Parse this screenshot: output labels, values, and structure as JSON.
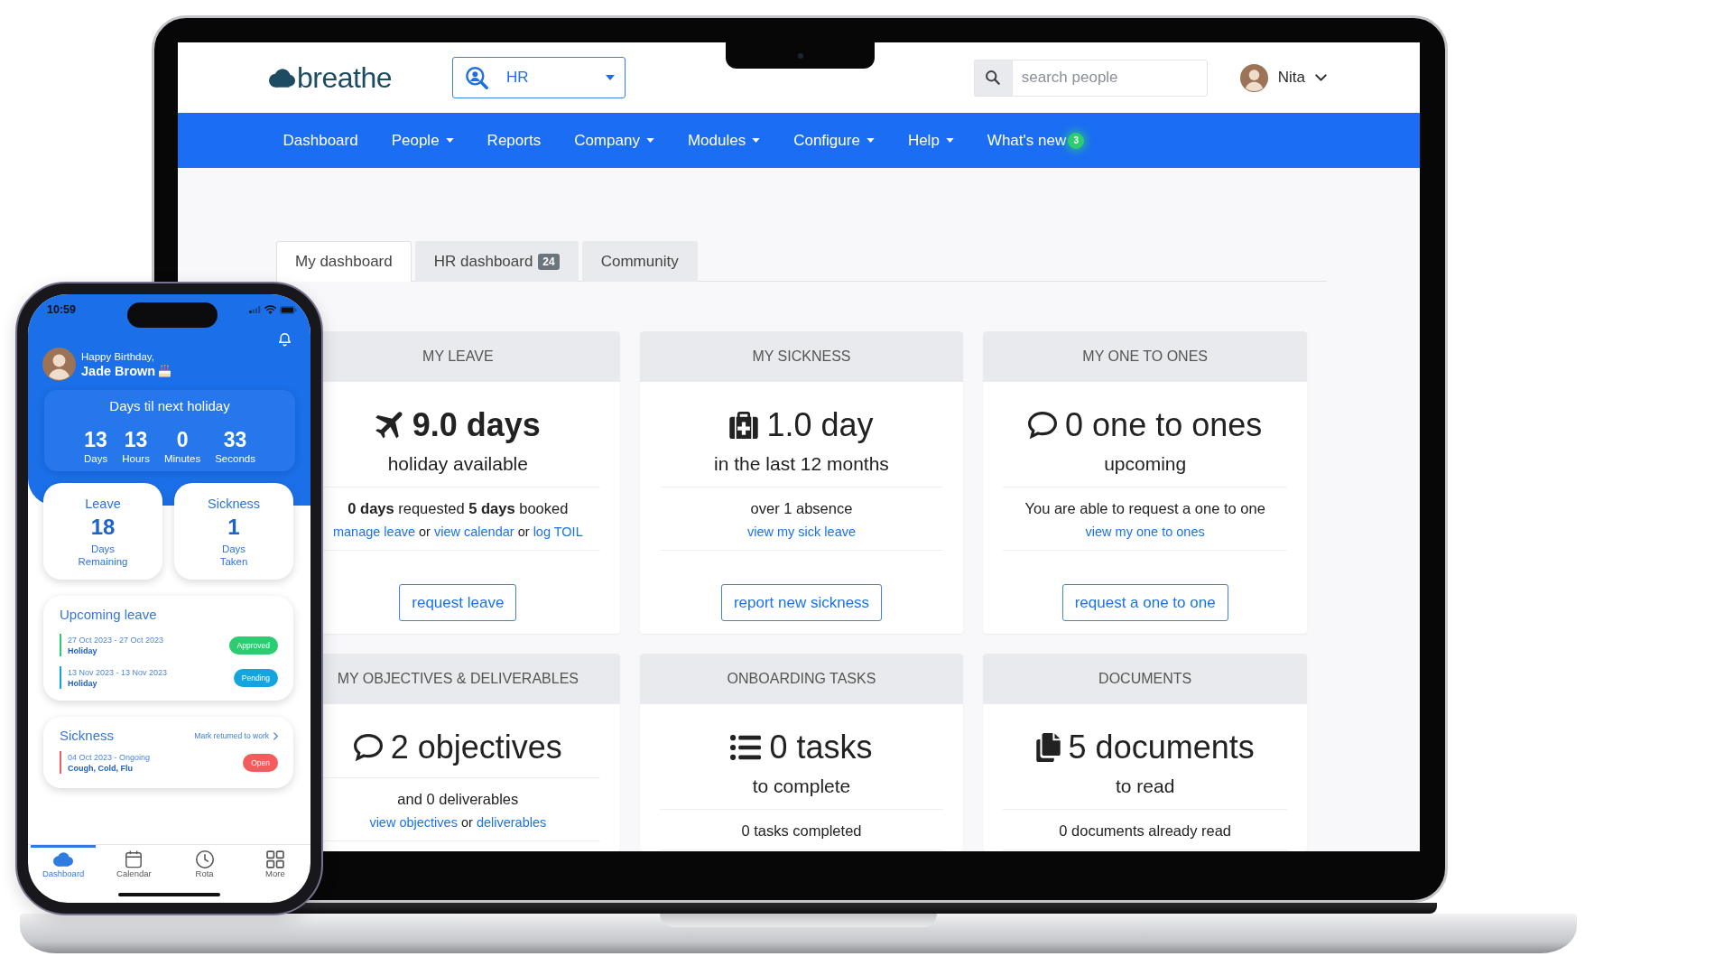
{
  "laptop": {
    "header": {
      "logo": "breathe",
      "module_select": {
        "value": "HR"
      },
      "search": {
        "placeholder": "search people"
      },
      "user_menu": {
        "name": "Nita"
      }
    },
    "nav": [
      {
        "label": "Dashboard",
        "dropdown": false
      },
      {
        "label": "People",
        "dropdown": true
      },
      {
        "label": "Reports",
        "dropdown": false
      },
      {
        "label": "Company",
        "dropdown": true
      },
      {
        "label": "Modules",
        "dropdown": true
      },
      {
        "label": "Configure",
        "dropdown": true
      },
      {
        "label": "Help",
        "dropdown": true
      },
      {
        "label": "What's new",
        "dropdown": false,
        "badge": "3"
      }
    ],
    "tabs": [
      {
        "label": "My dashboard",
        "selected": true
      },
      {
        "label": "HR dashboard",
        "badge": "24",
        "selected": false
      },
      {
        "label": "Community",
        "selected": false
      }
    ],
    "cards": [
      {
        "title": "MY LEAVE",
        "headline": "9.0 days",
        "bold": true,
        "subtitle": "holiday available",
        "detail": "**0 days** requested **5 days** booked",
        "links": [
          {
            "kind": "link",
            "text": "manage leave"
          },
          {
            "kind": "text",
            "text": "or"
          },
          {
            "kind": "link",
            "text": "view calendar"
          },
          {
            "kind": "text",
            "text": "or"
          },
          {
            "kind": "link",
            "text": "log TOIL"
          }
        ],
        "button": "request leave"
      },
      {
        "title": "MY SICKNESS",
        "headline": "1.0 day",
        "bold": false,
        "subtitle": "in the last 12 months",
        "detail": "over 1 absence",
        "links": [
          {
            "kind": "link",
            "text": "view my sick leave"
          }
        ],
        "button": "report new sickness"
      },
      {
        "title": "MY ONE TO ONES",
        "headline": "0 one to ones",
        "bold": false,
        "subtitle": "upcoming",
        "detail": "You are able to request a one to one",
        "links": [
          {
            "kind": "link",
            "text": "view my one to ones"
          }
        ],
        "button": "request a one to one"
      },
      {
        "title": "MY OBJECTIVES & DELIVERABLES",
        "headline": "2 objectives",
        "bold": false,
        "detail": "and 0 deliverables",
        "links": [
          {
            "kind": "link",
            "text": "view objectives"
          },
          {
            "kind": "text",
            "text": "or"
          },
          {
            "kind": "link",
            "text": "deliverables"
          }
        ]
      },
      {
        "title": "ONBOARDING TASKS",
        "headline": "0 tasks",
        "bold": false,
        "subtitle": "to complete",
        "detail": "0 tasks completed"
      },
      {
        "title": "DOCUMENTS",
        "headline": "5 documents",
        "bold": false,
        "subtitle": "to read",
        "detail": "0 documents already read"
      }
    ]
  },
  "phone": {
    "status_bar": {
      "time": "10:59"
    },
    "greeting": "Happy Birthday,",
    "user_name": "Jade Brown",
    "countdown": {
      "title": "Days til next holiday",
      "units": [
        {
          "value": "13",
          "label": "Days"
        },
        {
          "value": "13",
          "label": "Hours"
        },
        {
          "value": "0",
          "label": "Minutes"
        },
        {
          "value": "33",
          "label": "Seconds"
        }
      ]
    },
    "summary": [
      {
        "title": "Leave",
        "value": "18",
        "caption": "Days Remaining"
      },
      {
        "title": "Sickness",
        "value": "1",
        "caption": "Days Taken"
      }
    ],
    "upcoming_leave": {
      "title": "Upcoming leave",
      "entries": [
        {
          "dates": "27 Oct 2023 - 27 Oct 2023",
          "type": "Holiday",
          "status": "Approved",
          "color": "#2ecc71"
        },
        {
          "dates": "13 Nov 2023 - 13 Nov 2023",
          "type": "Holiday",
          "status": "Pending",
          "color": "#14a5e0"
        }
      ]
    },
    "sickness": {
      "title": "Sickness",
      "action": "Mark returned to work",
      "entries": [
        {
          "dates": "04 Oct 2023 - Ongoing",
          "type": "Cough, Cold, Flu",
          "status": "Open",
          "color": "#f25c5c"
        }
      ]
    },
    "tab_bar": [
      {
        "label": "Dashboard",
        "selected": true
      },
      {
        "label": "Calendar",
        "selected": false
      },
      {
        "label": "Rota",
        "selected": false
      },
      {
        "label": "More",
        "selected": false
      }
    ]
  }
}
